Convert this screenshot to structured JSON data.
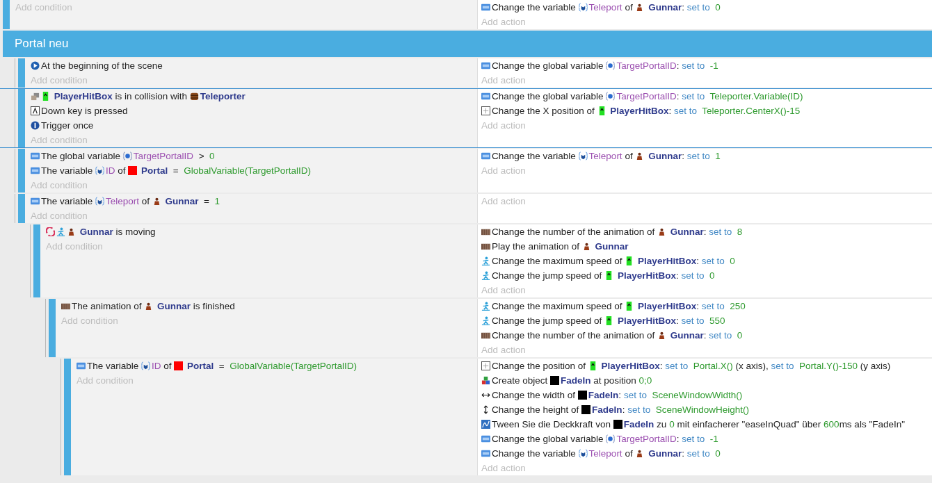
{
  "events": [
    {
      "kind": "event",
      "selected": false,
      "add_condition": "Add condition",
      "add_action": "Add action",
      "actions": [
        [
          {
            "kind": "var"
          },
          {
            "kind": "text",
            "text": "Change the variable "
          },
          {
            "kind": "objvar"
          },
          {
            "kind": "variable",
            "text": "Teleport"
          },
          {
            "kind": "text",
            "text": " of "
          },
          {
            "kind": "person"
          },
          {
            "kind": "object",
            "text": " Gunnar"
          },
          {
            "kind": "text",
            "text": ": "
          },
          {
            "kind": "keyword",
            "text": "set to"
          },
          {
            "kind": "value",
            "text": "  0"
          }
        ]
      ]
    },
    {
      "kind": "group",
      "title": "Portal neu",
      "children": [
        {
          "kind": "event",
          "selected": false,
          "add_condition": "Add condition",
          "add_action": "Add action",
          "conditions": [
            [
              {
                "kind": "scene-start"
              },
              {
                "kind": "text",
                "text": "At the beginning of the scene"
              }
            ]
          ],
          "actions": [
            [
              {
                "kind": "var"
              },
              {
                "kind": "text",
                "text": "Change the global variable "
              },
              {
                "kind": "globalvar"
              },
              {
                "kind": "variable",
                "text": "TargetPortalID"
              },
              {
                "kind": "text",
                "text": ": "
              },
              {
                "kind": "keyword",
                "text": "set to"
              },
              {
                "kind": "value",
                "text": "  -1"
              }
            ]
          ]
        },
        {
          "kind": "event",
          "selected": true,
          "add_condition": "Add condition",
          "add_action": "Add action",
          "conditions": [
            [
              {
                "kind": "collision"
              },
              {
                "kind": "hitbox"
              },
              {
                "kind": "object",
                "text": " PlayerHitBox"
              },
              {
                "kind": "text",
                "text": " is in collision with "
              },
              {
                "kind": "barrel"
              },
              {
                "kind": "object",
                "text": "Teleporter"
              }
            ],
            [
              {
                "kind": "key"
              },
              {
                "kind": "text",
                "text": "Down key is pressed"
              }
            ],
            [
              {
                "kind": "once"
              },
              {
                "kind": "text",
                "text": "Trigger once"
              }
            ]
          ],
          "actions": [
            [
              {
                "kind": "var"
              },
              {
                "kind": "text",
                "text": "Change the global variable "
              },
              {
                "kind": "globalvar"
              },
              {
                "kind": "variable",
                "text": "TargetPortalID"
              },
              {
                "kind": "text",
                "text": ": "
              },
              {
                "kind": "keyword",
                "text": "set to"
              },
              {
                "kind": "value",
                "text": "  Teleporter.Variable(ID)"
              }
            ],
            [
              {
                "kind": "position"
              },
              {
                "kind": "text",
                "text": "Change the X position of "
              },
              {
                "kind": "hitbox"
              },
              {
                "kind": "object",
                "text": " PlayerHitBox"
              },
              {
                "kind": "text",
                "text": ": "
              },
              {
                "kind": "keyword",
                "text": "set to"
              },
              {
                "kind": "value",
                "text": "  Teleporter.CenterX()-15"
              }
            ]
          ]
        },
        {
          "kind": "event",
          "selected": false,
          "add_condition": "Add condition",
          "add_action": "Add action",
          "conditions": [
            [
              {
                "kind": "var"
              },
              {
                "kind": "text",
                "text": "The global variable "
              },
              {
                "kind": "globalvar"
              },
              {
                "kind": "variable",
                "text": "TargetPortalID"
              },
              {
                "kind": "text",
                "text": "  >  "
              },
              {
                "kind": "value",
                "text": "0"
              }
            ],
            [
              {
                "kind": "var"
              },
              {
                "kind": "text",
                "text": "The variable "
              },
              {
                "kind": "objvar"
              },
              {
                "kind": "variable",
                "text": "ID"
              },
              {
                "kind": "text",
                "text": " of "
              },
              {
                "kind": "red-square"
              },
              {
                "kind": "object",
                "text": " Portal"
              },
              {
                "kind": "text",
                "text": "  =  "
              },
              {
                "kind": "value",
                "text": "GlobalVariable(TargetPortalID)"
              }
            ]
          ],
          "actions": [
            [
              {
                "kind": "var"
              },
              {
                "kind": "text",
                "text": "Change the variable "
              },
              {
                "kind": "objvar"
              },
              {
                "kind": "variable",
                "text": "Teleport"
              },
              {
                "kind": "text",
                "text": " of "
              },
              {
                "kind": "person"
              },
              {
                "kind": "object",
                "text": " Gunnar"
              },
              {
                "kind": "text",
                "text": ": "
              },
              {
                "kind": "keyword",
                "text": "set to"
              },
              {
                "kind": "value",
                "text": "  1"
              }
            ]
          ]
        },
        {
          "kind": "event",
          "selected": false,
          "add_condition": "Add condition",
          "add_action": "Add action",
          "conditions": [
            [
              {
                "kind": "var"
              },
              {
                "kind": "text",
                "text": "The variable "
              },
              {
                "kind": "objvar"
              },
              {
                "kind": "variable",
                "text": "Teleport"
              },
              {
                "kind": "text",
                "text": " of "
              },
              {
                "kind": "person"
              },
              {
                "kind": "object",
                "text": " Gunnar"
              },
              {
                "kind": "text",
                "text": "  =  "
              },
              {
                "kind": "value",
                "text": "1"
              }
            ]
          ],
          "children": [
            {
              "kind": "event",
              "selected": false,
              "add_condition": "Add condition",
              "add_action": "Add action",
              "conditions": [
                [
                  {
                    "kind": "moving"
                  },
                  {
                    "kind": "platformer"
                  },
                  {
                    "kind": "person"
                  },
                  {
                    "kind": "object",
                    "text": " Gunnar"
                  },
                  {
                    "kind": "text",
                    "text": " is moving"
                  }
                ]
              ],
              "actions": [
                [
                  {
                    "kind": "animation"
                  },
                  {
                    "kind": "text",
                    "text": "Change the number of the animation of "
                  },
                  {
                    "kind": "person"
                  },
                  {
                    "kind": "object",
                    "text": " Gunnar"
                  },
                  {
                    "kind": "text",
                    "text": ": "
                  },
                  {
                    "kind": "keyword",
                    "text": "set to"
                  },
                  {
                    "kind": "value",
                    "text": "  8"
                  }
                ],
                [
                  {
                    "kind": "animation"
                  },
                  {
                    "kind": "text",
                    "text": "Play the animation of "
                  },
                  {
                    "kind": "person"
                  },
                  {
                    "kind": "object",
                    "text": " Gunnar"
                  }
                ],
                [
                  {
                    "kind": "platformer"
                  },
                  {
                    "kind": "text",
                    "text": "Change the maximum speed of "
                  },
                  {
                    "kind": "hitbox"
                  },
                  {
                    "kind": "object",
                    "text": " PlayerHitBox"
                  },
                  {
                    "kind": "text",
                    "text": ": "
                  },
                  {
                    "kind": "keyword",
                    "text": "set to"
                  },
                  {
                    "kind": "value",
                    "text": "  0"
                  }
                ],
                [
                  {
                    "kind": "platformer"
                  },
                  {
                    "kind": "text",
                    "text": "Change the jump speed of "
                  },
                  {
                    "kind": "hitbox"
                  },
                  {
                    "kind": "object",
                    "text": " PlayerHitBox"
                  },
                  {
                    "kind": "text",
                    "text": ": "
                  },
                  {
                    "kind": "keyword",
                    "text": "set to"
                  },
                  {
                    "kind": "value",
                    "text": "  0"
                  }
                ]
              ],
              "children": [
                {
                  "kind": "event",
                  "selected": false,
                  "add_condition": "Add condition",
                  "add_action": "Add action",
                  "conditions": [
                    [
                      {
                        "kind": "animation"
                      },
                      {
                        "kind": "text",
                        "text": "The animation of "
                      },
                      {
                        "kind": "person"
                      },
                      {
                        "kind": "object",
                        "text": " Gunnar"
                      },
                      {
                        "kind": "text",
                        "text": " is finished"
                      }
                    ]
                  ],
                  "actions": [
                    [
                      {
                        "kind": "platformer"
                      },
                      {
                        "kind": "text",
                        "text": "Change the maximum speed of "
                      },
                      {
                        "kind": "hitbox"
                      },
                      {
                        "kind": "object",
                        "text": " PlayerHitBox"
                      },
                      {
                        "kind": "text",
                        "text": ": "
                      },
                      {
                        "kind": "keyword",
                        "text": "set to"
                      },
                      {
                        "kind": "value",
                        "text": "  250"
                      }
                    ],
                    [
                      {
                        "kind": "platformer"
                      },
                      {
                        "kind": "text",
                        "text": "Change the jump speed of "
                      },
                      {
                        "kind": "hitbox"
                      },
                      {
                        "kind": "object",
                        "text": " PlayerHitBox"
                      },
                      {
                        "kind": "text",
                        "text": ": "
                      },
                      {
                        "kind": "keyword",
                        "text": "set to"
                      },
                      {
                        "kind": "value",
                        "text": "  550"
                      }
                    ],
                    [
                      {
                        "kind": "animation"
                      },
                      {
                        "kind": "text",
                        "text": "Change the number of the animation of "
                      },
                      {
                        "kind": "person"
                      },
                      {
                        "kind": "object",
                        "text": " Gunnar"
                      },
                      {
                        "kind": "text",
                        "text": ": "
                      },
                      {
                        "kind": "keyword",
                        "text": "set to"
                      },
                      {
                        "kind": "value",
                        "text": "  0"
                      }
                    ]
                  ],
                  "children": [
                    {
                      "kind": "event",
                      "selected": false,
                      "add_condition": "Add condition",
                      "add_action": "Add action",
                      "conditions": [
                        [
                          {
                            "kind": "var"
                          },
                          {
                            "kind": "text",
                            "text": "The variable "
                          },
                          {
                            "kind": "objvar"
                          },
                          {
                            "kind": "variable",
                            "text": "ID"
                          },
                          {
                            "kind": "text",
                            "text": " of "
                          },
                          {
                            "kind": "red-square"
                          },
                          {
                            "kind": "object",
                            "text": " Portal"
                          },
                          {
                            "kind": "text",
                            "text": "  =  "
                          },
                          {
                            "kind": "value",
                            "text": "GlobalVariable(TargetPortalID)"
                          }
                        ]
                      ],
                      "actions": [
                        [
                          {
                            "kind": "position"
                          },
                          {
                            "kind": "text",
                            "text": "Change the position of "
                          },
                          {
                            "kind": "hitbox"
                          },
                          {
                            "kind": "object",
                            "text": " PlayerHitBox"
                          },
                          {
                            "kind": "text",
                            "text": ": "
                          },
                          {
                            "kind": "keyword",
                            "text": "set to"
                          },
                          {
                            "kind": "value",
                            "text": "  Portal.X()"
                          },
                          {
                            "kind": "text",
                            "text": " (x axis), "
                          },
                          {
                            "kind": "keyword",
                            "text": "set to"
                          },
                          {
                            "kind": "value",
                            "text": "  Portal.Y()-150"
                          },
                          {
                            "kind": "text",
                            "text": " (y axis)"
                          }
                        ],
                        [
                          {
                            "kind": "create"
                          },
                          {
                            "kind": "text",
                            "text": "Create object "
                          },
                          {
                            "kind": "black-square"
                          },
                          {
                            "kind": "object",
                            "text": "FadeIn"
                          },
                          {
                            "kind": "text",
                            "text": " at position "
                          },
                          {
                            "kind": "value",
                            "text": "0;0"
                          }
                        ],
                        [
                          {
                            "kind": "width"
                          },
                          {
                            "kind": "text",
                            "text": "Change the width of "
                          },
                          {
                            "kind": "black-square"
                          },
                          {
                            "kind": "object",
                            "text": "FadeIn"
                          },
                          {
                            "kind": "text",
                            "text": ": "
                          },
                          {
                            "kind": "keyword",
                            "text": "set to"
                          },
                          {
                            "kind": "value",
                            "text": "  SceneWindowWidth()"
                          }
                        ],
                        [
                          {
                            "kind": "height"
                          },
                          {
                            "kind": "text",
                            "text": "Change the height of "
                          },
                          {
                            "kind": "black-square"
                          },
                          {
                            "kind": "object",
                            "text": "FadeIn"
                          },
                          {
                            "kind": "text",
                            "text": ": "
                          },
                          {
                            "kind": "keyword",
                            "text": "set to"
                          },
                          {
                            "kind": "value",
                            "text": "  SceneWindowHeight()"
                          }
                        ],
                        [
                          {
                            "kind": "tween"
                          },
                          {
                            "kind": "text",
                            "text": "Tween Sie die Deckkraft von "
                          },
                          {
                            "kind": "black-square"
                          },
                          {
                            "kind": "object",
                            "text": "FadeIn"
                          },
                          {
                            "kind": "text",
                            "text": " zu "
                          },
                          {
                            "kind": "value",
                            "text": "0"
                          },
                          {
                            "kind": "text",
                            "text": " mit einfacherer \"easeInQuad\" über "
                          },
                          {
                            "kind": "value",
                            "text": "600"
                          },
                          {
                            "kind": "text",
                            "text": "ms als \"FadeIn\""
                          }
                        ],
                        [
                          {
                            "kind": "var"
                          },
                          {
                            "kind": "text",
                            "text": "Change the global variable "
                          },
                          {
                            "kind": "globalvar"
                          },
                          {
                            "kind": "variable",
                            "text": "TargetPortalID"
                          },
                          {
                            "kind": "text",
                            "text": ": "
                          },
                          {
                            "kind": "keyword",
                            "text": "set to"
                          },
                          {
                            "kind": "value",
                            "text": "  -1"
                          }
                        ],
                        [
                          {
                            "kind": "var"
                          },
                          {
                            "kind": "text",
                            "text": "Change the variable "
                          },
                          {
                            "kind": "objvar"
                          },
                          {
                            "kind": "variable",
                            "text": "Teleport"
                          },
                          {
                            "kind": "text",
                            "text": " of "
                          },
                          {
                            "kind": "person"
                          },
                          {
                            "kind": "object",
                            "text": " Gunnar"
                          },
                          {
                            "kind": "text",
                            "text": ": "
                          },
                          {
                            "kind": "keyword",
                            "text": "set to"
                          },
                          {
                            "kind": "value",
                            "text": "  0"
                          }
                        ]
                      ]
                    }
                  ]
                }
              ]
            }
          ]
        }
      ]
    }
  ]
}
